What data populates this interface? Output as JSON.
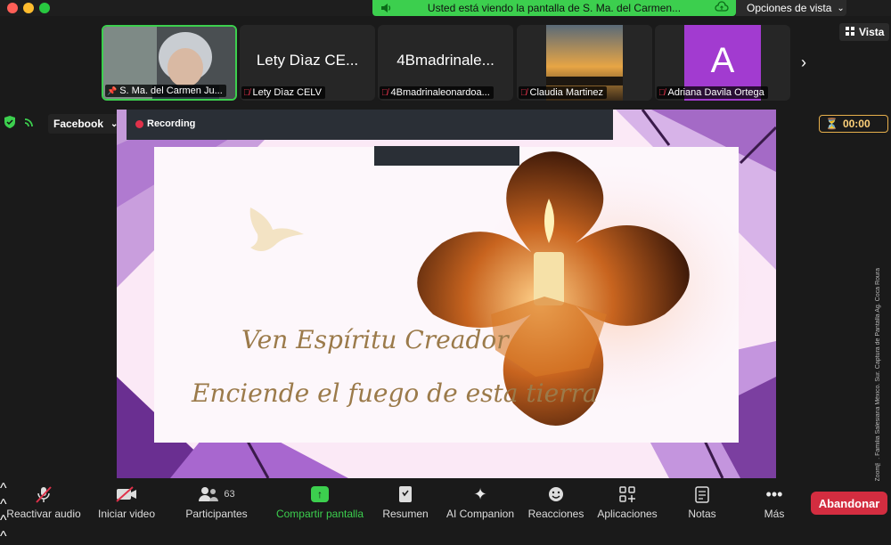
{
  "banner": {
    "text": "Usted está viendo la pantalla de S. Ma. del Carmen..."
  },
  "view_options": {
    "label": "Opciones de vista"
  },
  "vista": {
    "label": "Vista"
  },
  "participants_strip": [
    {
      "big": "",
      "name": "S. Ma. del Carmen Ju..."
    },
    {
      "big": "Lety Dìaz CE...",
      "name": "Lety Dìaz CELV"
    },
    {
      "big": "4Bmadrinale...",
      "name": "4Bmadrinaleonardoa..."
    },
    {
      "big": "",
      "name": "Claudia Martinez"
    },
    {
      "big": "A",
      "name": "Adriana Davila Ortega"
    }
  ],
  "stream": {
    "platform": "Facebook"
  },
  "recording": {
    "label": "Recording"
  },
  "timer": {
    "value": "00:00"
  },
  "slide": {
    "line1": "Ven Espíritu Creador",
    "line2": "Enciende el fuego de esta tierra"
  },
  "watermark": "Cortesía © Zoom™. Familia Salesiana México. Sur. Captura de Pantalla Ag. Coca Roura",
  "toolbar": {
    "audio": "Reactivar audio",
    "video": "Iniciar video",
    "participants": "Participantes",
    "participants_count": "63",
    "share": "Compartir pantalla",
    "summary": "Resumen",
    "companion": "AI Companion",
    "reactions": "Reacciones",
    "apps": "Aplicaciones",
    "notes": "Notas",
    "more": "Más",
    "leave": "Abandonar"
  },
  "colors": {
    "accent_green": "#3ccf4e",
    "leave_red": "#d32d40",
    "slide_purple": "#7b3fa0"
  }
}
